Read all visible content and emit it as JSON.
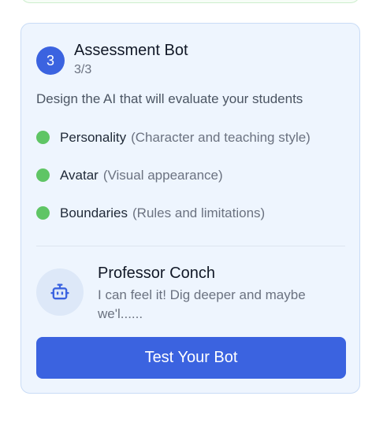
{
  "card": {
    "step_number": "3",
    "title": "Assessment Bot",
    "progress": "3/3",
    "description": "Design the AI that will evaluate your students",
    "checklist": [
      {
        "label": "Personality",
        "hint": "(Character and teaching style)",
        "status": "complete"
      },
      {
        "label": "Avatar",
        "hint": "(Visual appearance)",
        "status": "complete"
      },
      {
        "label": "Boundaries",
        "hint": "(Rules and limitations)",
        "status": "complete"
      }
    ],
    "bot_preview": {
      "icon": "robot-icon",
      "name": "Professor Conch",
      "message": "I can feel it! Dig deeper and maybe we'l......"
    },
    "button_label": "Test Your Bot"
  },
  "colors": {
    "accent": "#3b63e0",
    "complete": "#5fc565",
    "card_background": "#eef5fe"
  }
}
